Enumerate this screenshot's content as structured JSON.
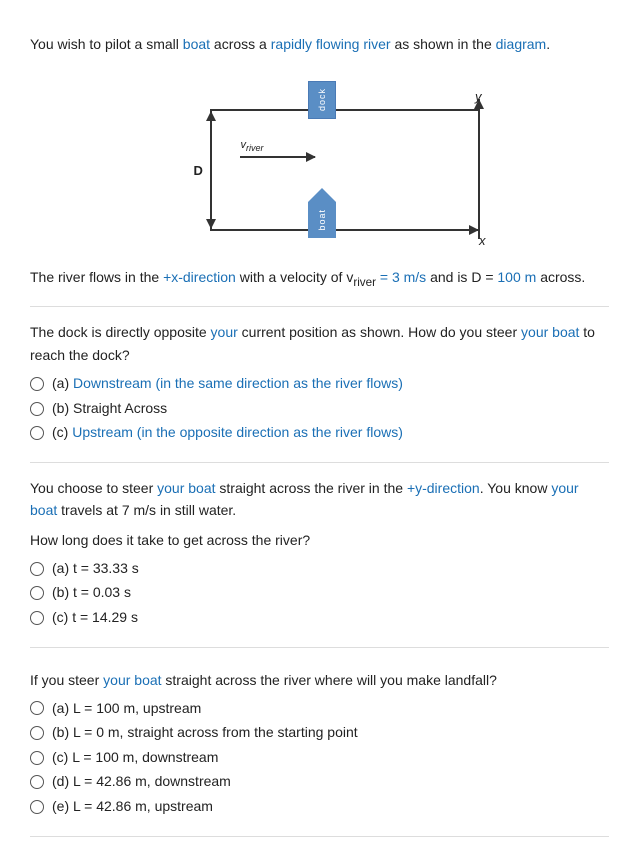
{
  "intro": {
    "text": "You wish to pilot a small boat across a rapidly flowing river as shown in the diagram.",
    "highlight_words": [
      "boat",
      "rapidly",
      "flowing",
      "river",
      "diagram"
    ]
  },
  "river_info": {
    "text_prefix": "The river flows in the +x-direction with a velocity of v",
    "subscript": "river",
    "text_mid": " = 3 m/s and is D = ",
    "text_suffix": "100 m across.",
    "v_river_label": "v_river",
    "D_label": "D"
  },
  "diagram": {
    "v_river_arrow_label": "vₐriver",
    "d_label": "D",
    "dock_text": "dock",
    "boat_text": "boat",
    "y_label": "y",
    "x_label": "x"
  },
  "section1": {
    "text": "The dock is directly opposite your current position as shown. How do you steer your boat to reach the dock?",
    "highlight_words": [
      "your",
      "boat"
    ],
    "options": [
      {
        "id": "a",
        "label": "(a) Downstream (in the same direction as the river flows)"
      },
      {
        "id": "b",
        "label": "(b) Straight Across"
      },
      {
        "id": "c",
        "label": "(c) Upstream (in the opposite direction as the river flows)"
      }
    ],
    "highlighted_options": [
      0,
      2
    ]
  },
  "section2": {
    "text1": "You choose to steer your boat straight across the river in the +y-direction. You know your boat travels at 7 m/s in still water.",
    "highlight_words": [
      "your",
      "boat",
      "+y-direction",
      "your",
      "boat"
    ],
    "question": "How long does it take to get across the river?",
    "options": [
      {
        "id": "a",
        "label": "(a) t = 33.33 s"
      },
      {
        "id": "b",
        "label": "(b) t = 0.03 s"
      },
      {
        "id": "c",
        "label": "(c) t = 14.29 s"
      }
    ]
  },
  "section3": {
    "question": "If you steer your boat straight across the river where will you make landfall?",
    "highlight_words": [
      "your",
      "boat"
    ],
    "options": [
      {
        "id": "a",
        "label": "(a) L = 100 m, upstream"
      },
      {
        "id": "b",
        "label": "(b) L = 0 m, straight across from the starting point"
      },
      {
        "id": "c",
        "label": "(c) L = 100 m, downstream"
      },
      {
        "id": "d",
        "label": "(d) L = 42.86 m, downstream"
      },
      {
        "id": "e",
        "label": "(e) L = 42.86 m, upstream"
      }
    ]
  }
}
